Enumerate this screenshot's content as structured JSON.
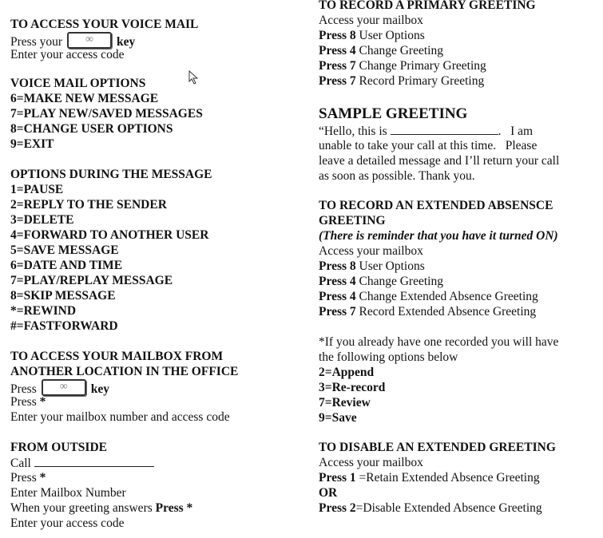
{
  "left": [
    {
      "title": "TO ACCESS YOUR VOICE MAIL",
      "lines": [
        [
          {
            "t": "Press your"
          },
          {
            "key": "voicemail-key-icon"
          },
          {
            "b": "key"
          }
        ],
        [
          {
            "t": "Enter your access code"
          }
        ]
      ]
    },
    {
      "title": "VOICE MAIL OPTIONS",
      "lines": [
        [
          {
            "b": "6=MAKE NEW MESSAGE"
          }
        ],
        [
          {
            "b": "7=PLAY NEW/SAVED MESSAGES"
          }
        ],
        [
          {
            "b": "8=CHANGE USER OPTIONS"
          }
        ],
        [
          {
            "b": "9=EXIT"
          }
        ]
      ]
    },
    {
      "title": "OPTIONS DURING THE MESSAGE",
      "lines": [
        [
          {
            "b": "1=PAUSE"
          }
        ],
        [
          {
            "b": "2=REPLY TO THE SENDER"
          }
        ],
        [
          {
            "b": "3=DELETE"
          }
        ],
        [
          {
            "b": "4=FORWARD TO ANOTHER USER"
          }
        ],
        [
          {
            "b": "5=SAVE MESSAGE"
          }
        ],
        [
          {
            "b": "6=DATE AND TIME"
          }
        ],
        [
          {
            "b": "7=PLAY/REPLAY MESSAGE"
          }
        ],
        [
          {
            "b": "8=SKIP MESSAGE"
          }
        ],
        [
          {
            "b": "*=REWIND"
          }
        ],
        [
          {
            "b": "#=FASTFORWARD"
          }
        ]
      ]
    },
    {
      "title": "TO ACCESS YOUR MAILBOX FROM",
      "title2": "ANOTHER LOCATION IN THE OFFICE",
      "lines": [
        [
          {
            "t": "Press"
          },
          {
            "key": "voicemail-key-icon"
          },
          {
            "b": "key"
          }
        ],
        [
          {
            "t": "Press "
          },
          {
            "b": "*"
          }
        ],
        [
          {
            "t": "Enter your mailbox number and access code"
          }
        ]
      ]
    },
    {
      "title": "FROM OUTSIDE",
      "lines": [
        [
          {
            "t": "Call "
          },
          {
            "blank": 150
          }
        ],
        [
          {
            "t": "Press "
          },
          {
            "b": "*"
          }
        ],
        [
          {
            "t": "Enter Mailbox Number"
          }
        ],
        [
          {
            "t": "When your greeting answers "
          },
          {
            "b": "Press *"
          }
        ],
        [
          {
            "t": "Enter your access code"
          }
        ]
      ]
    }
  ],
  "right": [
    {
      "title": "TO RECORD A PRIMARY GREETING",
      "lines": [
        [
          {
            "t": "Access your mailbox"
          }
        ],
        [
          {
            "b": "Press 8"
          },
          {
            "t": " User Options"
          }
        ],
        [
          {
            "b": "Press 4"
          },
          {
            "t": " Change Greeting"
          }
        ],
        [
          {
            "b": "Press 7"
          },
          {
            "t": " Change Primary Greeting"
          }
        ],
        [
          {
            "b": "Press 7"
          },
          {
            "t": " Record Primary Greeting"
          }
        ]
      ]
    },
    {
      "title": "SAMPLE GREETING",
      "big": true,
      "lines": [
        [
          {
            "t": "“Hello, this is "
          },
          {
            "blank": 135
          },
          {
            "t": ".   I am"
          }
        ],
        [
          {
            "t": "unable to take your call at this time.   Please"
          }
        ],
        [
          {
            "t": "leave a detailed message and I’ll return your call"
          }
        ],
        [
          {
            "t": "as soon as possible. Thank you."
          }
        ]
      ]
    },
    {
      "title": "TO RECORD AN EXTENDED ABSENSCE",
      "title2": "GREETING",
      "lines": [
        [
          {
            "i": "(There is reminder that you have it turned ON)"
          }
        ],
        [
          {
            "t": "Access your mailbox"
          }
        ],
        [
          {
            "b": "Press 8"
          },
          {
            "t": " User Options"
          }
        ],
        [
          {
            "b": "Press 4"
          },
          {
            "t": " Change Greeting"
          }
        ],
        [
          {
            "b": "Press 4"
          },
          {
            "t": " Change Extended Absence Greeting"
          }
        ],
        [
          {
            "b": "Press 7"
          },
          {
            "t": " Record Extended Absence Greeting"
          }
        ]
      ]
    },
    {
      "title": "",
      "lines": [
        [
          {
            "t": "*If you already have one recorded you will have"
          }
        ],
        [
          {
            "t": "the following options below"
          }
        ],
        [
          {
            "b": "2=Append"
          }
        ],
        [
          {
            "b": "3=Re-record"
          }
        ],
        [
          {
            "b": "7=Review"
          }
        ],
        [
          {
            "b": "9=Save"
          }
        ]
      ]
    },
    {
      "title": "TO DISABLE AN EXTENDED GREETING",
      "lines": [
        [
          {
            "t": "Access your mailbox"
          }
        ],
        [
          {
            "b": "Press 1"
          },
          {
            "t": " =Retain Extended Absence Greeting"
          }
        ],
        [
          {
            "b": "OR"
          }
        ],
        [
          {
            "b": "Press 2"
          },
          {
            "t": "=Disable Extended Absence Greeting"
          }
        ]
      ]
    }
  ]
}
